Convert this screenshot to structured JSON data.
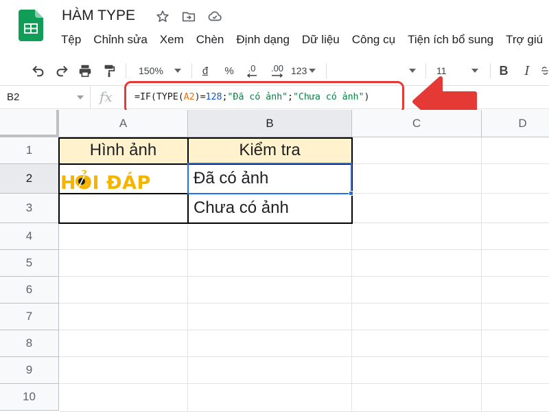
{
  "app": {
    "doc_title": "HÀM TYPE",
    "icons": [
      "sheets-logo",
      "star-icon",
      "move-to-folder-icon",
      "cloud-saved-icon"
    ]
  },
  "menu": [
    "Tệp",
    "Chỉnh sửa",
    "Xem",
    "Chèn",
    "Định dạng",
    "Dữ liệu",
    "Công cụ",
    "Tiện ích bổ sung",
    "Trợ giú"
  ],
  "toolbar": {
    "zoom": "150%",
    "currency": "đ",
    "percent": "%",
    "decrease_decimal": ".0",
    "increase_decimal": ".00",
    "more_formats": "123",
    "font_size": "11",
    "bold": "B",
    "italic": "I",
    "icons": [
      "undo-icon",
      "redo-icon",
      "print-icon",
      "paint-format-icon",
      "strikethrough-icon"
    ]
  },
  "formula_bar": {
    "cell_ref": "B2",
    "fx": "fx",
    "formula_parts": {
      "p1": "=IF(TYPE(",
      "p2": "A2",
      "p3": ")=",
      "p4": "128",
      "p5": ";",
      "p6": "\"Đã có ảnh\"",
      "p7": ";",
      "p8": "\"Chưa có ảnh\"",
      "p9": ")"
    }
  },
  "grid": {
    "columns": [
      "A",
      "B",
      "C",
      "D"
    ],
    "rows": [
      "1",
      "2",
      "3",
      "4",
      "5",
      "6",
      "7",
      "8",
      "9",
      "10"
    ],
    "active_cell": "B2",
    "cells": {
      "A1": "Hình ảnh",
      "B1": "Kiểm tra",
      "B2": "Đã có ảnh",
      "B3": "Chưa có ảnh"
    },
    "image_in_A2": {
      "text": "HỎI ĐÁP",
      "color": "#f5b400"
    }
  },
  "colors": {
    "header_fill": "#fff2cc",
    "selection": "#1a73e8",
    "annotation": "#e53935",
    "sheets_green": "#0f9d58"
  }
}
